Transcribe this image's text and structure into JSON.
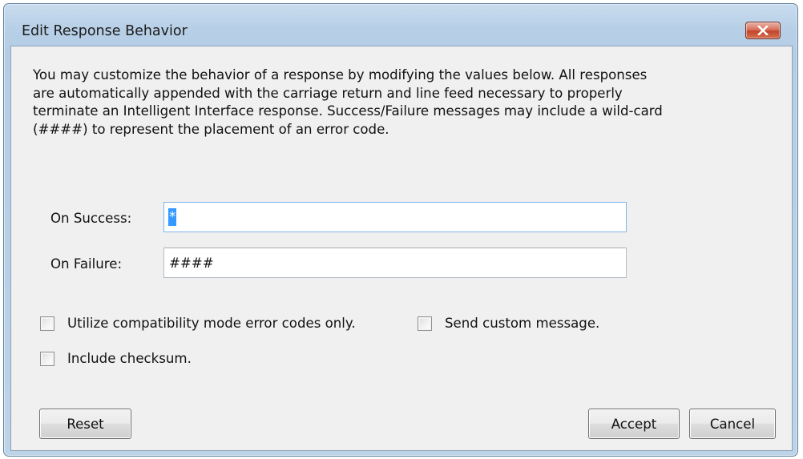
{
  "window": {
    "title": "Edit Response Behavior",
    "close_icon": "close-icon"
  },
  "description": "You may customize the behavior of a response by modifying the values below. All responses\nare automatically appended with the carriage return and line feed necessary to properly\nterminate an Intelligent Interface response. Success/Failure messages may include a wild-card\n(####) to represent the placement of an error code.",
  "fields": {
    "on_success": {
      "label": "On Success:",
      "value": "*",
      "selected": true
    },
    "on_failure": {
      "label": "On Failure:",
      "value": "####"
    }
  },
  "checkboxes": {
    "compatibility_mode": {
      "label": "Utilize compatibility mode error codes only.",
      "checked": false
    },
    "custom_message": {
      "label": "Send custom message.",
      "checked": false
    },
    "include_checksum": {
      "label": "Include checksum.",
      "checked": false
    }
  },
  "buttons": {
    "reset": "Reset",
    "accept": "Accept",
    "cancel": "Cancel"
  },
  "colors": {
    "frame": "#b4cde5",
    "client": "#f0f0f0",
    "close_button": "#c2462d",
    "selection": "#3399ff"
  }
}
